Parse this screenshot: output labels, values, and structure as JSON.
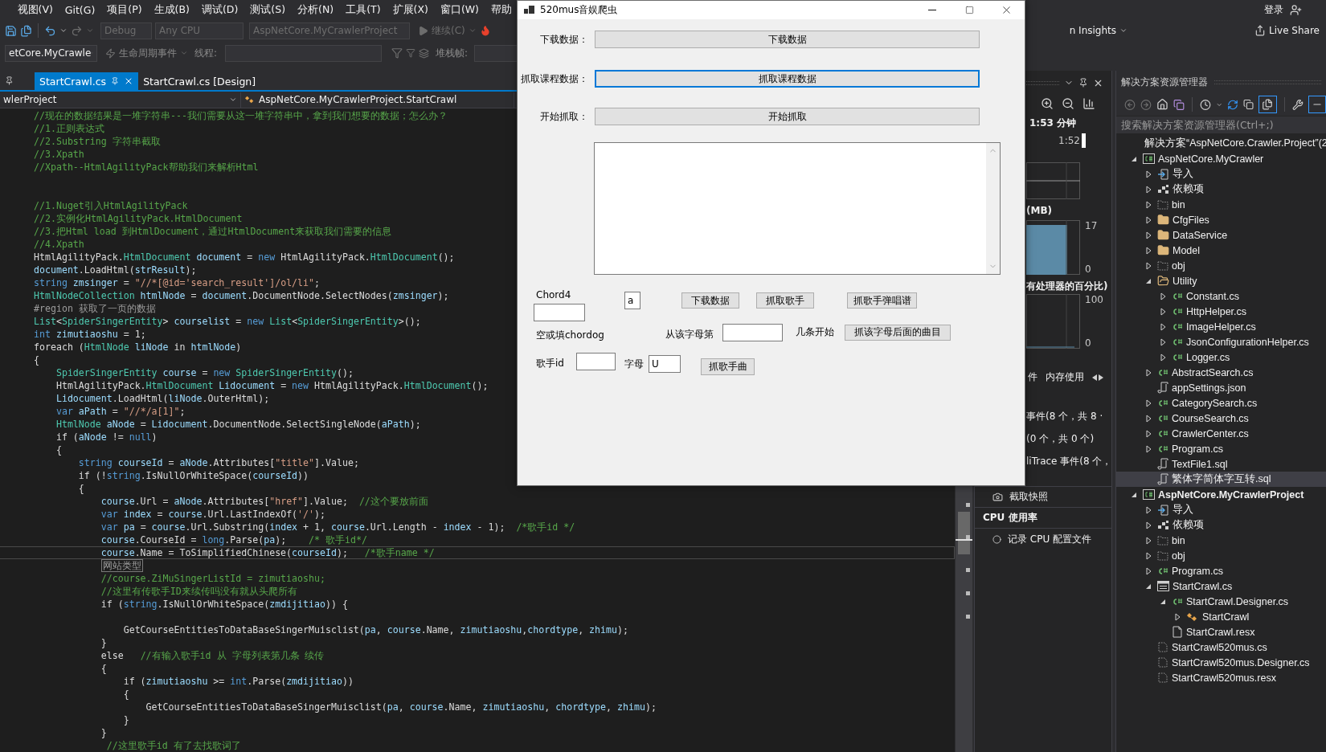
{
  "menu": {
    "items": [
      "视图(V)",
      "Git(G)",
      "项目(P)",
      "生成(B)",
      "调试(D)",
      "测试(S)",
      "分析(N)",
      "工具(T)",
      "扩展(X)",
      "窗口(W)",
      "帮助"
    ],
    "login": "登录"
  },
  "toolbar": {
    "config": {
      "text": "Debug",
      "disabled": true
    },
    "platform": {
      "text": "Any CPU",
      "disabled": true
    },
    "startup_project": {
      "text": "AspNetCore.MyCrawlerProject",
      "disabled": true
    },
    "continue": {
      "text": "继续(C)",
      "disabled": true
    },
    "insights": "n Insights",
    "live_share": "Live Share"
  },
  "debug_toolbar": {
    "process": "etCore.MyCrawle",
    "lifecycle": "生命周期事件",
    "thread_label": "线程:",
    "stack_label": "堆栈帧:"
  },
  "editor": {
    "tabs": [
      {
        "label": "StartCrawl.cs",
        "selected": true
      },
      {
        "label": "StartCrawl.cs [Design]",
        "selected": false
      }
    ],
    "nav_project": "wlerProject",
    "nav_class": "AspNetCore.MyCrawlerProject.StartCrawl",
    "lines": [
      {
        "kind": "code",
        "current": false,
        "tokens": [
          {
            "kind": "comment",
            "text": "//现在的数据结果是一堆字符串---我们需要从这一堆字符串中，拿到我们想要的数据；怎么办？"
          }
        ]
      },
      {
        "kind": "code",
        "current": false,
        "tokens": [
          {
            "kind": "comment",
            "text": "//1.正则表达式"
          }
        ]
      },
      {
        "kind": "code",
        "current": false,
        "tokens": [
          {
            "kind": "comment",
            "text": "//2.Substring 字符串截取"
          }
        ]
      },
      {
        "kind": "code",
        "current": false,
        "tokens": [
          {
            "kind": "comment",
            "text": "//3.Xpath"
          }
        ]
      },
      {
        "kind": "code",
        "current": false,
        "tokens": [
          {
            "kind": "comment",
            "text": "//Xpath--HtmlAgilityPack帮助我们来解析Html"
          }
        ]
      },
      {
        "kind": "blank",
        "current": false
      },
      {
        "kind": "blank",
        "current": false
      },
      {
        "kind": "code",
        "current": false,
        "tokens": [
          {
            "kind": "comment",
            "text": "//1.Nuget引入HtmlAgilityPack"
          }
        ]
      },
      {
        "kind": "code",
        "current": false,
        "tokens": [
          {
            "kind": "comment",
            "text": "//2.实例化HtmlAgilityPack.HtmlDocument"
          }
        ]
      },
      {
        "kind": "code",
        "current": false,
        "tokens": [
          {
            "kind": "comment",
            "text": "//3.把Html load 到HtmlDocument，通过HtmlDocument来获取我们需要的信息"
          }
        ]
      },
      {
        "kind": "code",
        "current": false,
        "tokens": [
          {
            "kind": "comment",
            "text": "//4.Xpath"
          }
        ]
      },
      {
        "kind": "code",
        "current": false,
        "tokens": [
          {
            "kind": "plain",
            "text": "HtmlAgilityPack."
          },
          {
            "kind": "type",
            "text": "HtmlDocument"
          },
          {
            "kind": "variable",
            "text": " document"
          },
          {
            "kind": "plain",
            "text": " = "
          },
          {
            "kind": "keyword",
            "text": "new"
          },
          {
            "kind": "plain",
            "text": " HtmlAgilityPack."
          },
          {
            "kind": "type",
            "text": "HtmlDocument"
          },
          {
            "kind": "plain",
            "text": "();"
          }
        ]
      },
      {
        "kind": "code",
        "current": false,
        "tokens": [
          {
            "kind": "variable",
            "text": "document"
          },
          {
            "kind": "plain",
            "text": ".LoadHtml("
          },
          {
            "kind": "variable",
            "text": "strResult"
          },
          {
            "kind": "plain",
            "text": ");"
          }
        ]
      },
      {
        "kind": "code",
        "current": false,
        "tokens": [
          {
            "kind": "keyword",
            "text": "string"
          },
          {
            "kind": "variable",
            "text": " zmsinger"
          },
          {
            "kind": "plain",
            "text": " = "
          },
          {
            "kind": "string",
            "text": "\"//*[@id='search_result']/ol/li\""
          },
          {
            "kind": "plain",
            "text": ";"
          }
        ]
      },
      {
        "kind": "code",
        "current": false,
        "tokens": [
          {
            "kind": "type",
            "text": "HtmlNodeCollection"
          },
          {
            "kind": "variable",
            "text": " htmlNode"
          },
          {
            "kind": "plain",
            "text": " = "
          },
          {
            "kind": "variable",
            "text": "document"
          },
          {
            "kind": "plain",
            "text": ".DocumentNode.SelectNodes("
          },
          {
            "kind": "variable",
            "text": "zmsinger"
          },
          {
            "kind": "plain",
            "text": ");"
          }
        ]
      },
      {
        "kind": "code",
        "current": false,
        "tokens": [
          {
            "kind": "directive",
            "text": "#region 获取了一页的数据"
          }
        ]
      },
      {
        "kind": "code",
        "current": false,
        "tokens": [
          {
            "kind": "type",
            "text": "List"
          },
          {
            "kind": "plain",
            "text": "<"
          },
          {
            "kind": "type",
            "text": "SpiderSingerEntity"
          },
          {
            "kind": "plain",
            "text": "> "
          },
          {
            "kind": "variable",
            "text": "courselist"
          },
          {
            "kind": "plain",
            "text": " = "
          },
          {
            "kind": "keyword",
            "text": "new"
          },
          {
            "kind": "type",
            "text": " List"
          },
          {
            "kind": "plain",
            "text": "<"
          },
          {
            "kind": "type",
            "text": "SpiderSingerEntity"
          },
          {
            "kind": "plain",
            "text": ">();"
          }
        ]
      },
      {
        "kind": "code",
        "current": false,
        "tokens": [
          {
            "kind": "keyword",
            "text": "int"
          },
          {
            "kind": "variable",
            "text": " zimutiaoshu"
          },
          {
            "kind": "plain",
            "text": " = 1;"
          }
        ]
      },
      {
        "kind": "code",
        "current": false,
        "tokens": [
          {
            "kind": "plain",
            "text": "foreach ("
          },
          {
            "kind": "type",
            "text": "HtmlNode"
          },
          {
            "kind": "variable",
            "text": " liNode"
          },
          {
            "kind": "plain",
            "text": " in "
          },
          {
            "kind": "variable",
            "text": "htmlNode"
          },
          {
            "kind": "plain",
            "text": ")"
          }
        ]
      },
      {
        "kind": "code",
        "current": false,
        "tokens": [
          {
            "kind": "plain",
            "text": "{"
          }
        ]
      },
      {
        "kind": "code",
        "current": false,
        "tokens": [
          {
            "kind": "type",
            "text": "    SpiderSingerEntity"
          },
          {
            "kind": "variable",
            "text": " course"
          },
          {
            "kind": "plain",
            "text": " = "
          },
          {
            "kind": "keyword",
            "text": "new"
          },
          {
            "kind": "type",
            "text": " SpiderSingerEntity"
          },
          {
            "kind": "plain",
            "text": "();"
          }
        ]
      },
      {
        "kind": "code",
        "current": false,
        "tokens": [
          {
            "kind": "plain",
            "text": "    HtmlAgilityPack."
          },
          {
            "kind": "type",
            "text": "HtmlDocument"
          },
          {
            "kind": "variable",
            "text": " Lidocument"
          },
          {
            "kind": "plain",
            "text": " = "
          },
          {
            "kind": "keyword",
            "text": "new"
          },
          {
            "kind": "plain",
            "text": " HtmlAgilityPack."
          },
          {
            "kind": "type",
            "text": "HtmlDocument"
          },
          {
            "kind": "plain",
            "text": "();"
          }
        ]
      },
      {
        "kind": "code",
        "current": false,
        "tokens": [
          {
            "kind": "variable",
            "text": "    Lidocument"
          },
          {
            "kind": "plain",
            "text": ".LoadHtml("
          },
          {
            "kind": "variable",
            "text": "liNode"
          },
          {
            "kind": "plain",
            "text": ".OuterHtml);"
          }
        ]
      },
      {
        "kind": "code",
        "current": false,
        "tokens": [
          {
            "kind": "keyword",
            "text": "    var"
          },
          {
            "kind": "variable",
            "text": " aPath"
          },
          {
            "kind": "plain",
            "text": " = "
          },
          {
            "kind": "string",
            "text": "\"//*/a[1]\""
          },
          {
            "kind": "plain",
            "text": ";"
          }
        ]
      },
      {
        "kind": "code",
        "current": false,
        "tokens": [
          {
            "kind": "type",
            "text": "    HtmlNode"
          },
          {
            "kind": "variable",
            "text": " aNode"
          },
          {
            "kind": "plain",
            "text": " = "
          },
          {
            "kind": "variable",
            "text": "Lidocument"
          },
          {
            "kind": "plain",
            "text": ".DocumentNode.SelectSingleNode("
          },
          {
            "kind": "variable",
            "text": "aPath"
          },
          {
            "kind": "plain",
            "text": ");"
          }
        ]
      },
      {
        "kind": "code",
        "current": false,
        "tokens": [
          {
            "kind": "plain",
            "text": "    if ("
          },
          {
            "kind": "variable",
            "text": "aNode"
          },
          {
            "kind": "plain",
            "text": " != "
          },
          {
            "kind": "keyword",
            "text": "null"
          },
          {
            "kind": "plain",
            "text": ")"
          }
        ]
      },
      {
        "kind": "code",
        "current": false,
        "tokens": [
          {
            "kind": "plain",
            "text": "    {"
          }
        ]
      },
      {
        "kind": "code",
        "current": false,
        "tokens": [
          {
            "kind": "keyword",
            "text": "        string"
          },
          {
            "kind": "variable",
            "text": " courseId"
          },
          {
            "kind": "plain",
            "text": " = "
          },
          {
            "kind": "variable",
            "text": "aNode"
          },
          {
            "kind": "plain",
            "text": ".Attributes["
          },
          {
            "kind": "string",
            "text": "\"title\""
          },
          {
            "kind": "plain",
            "text": "].Value;"
          }
        ]
      },
      {
        "kind": "code",
        "current": false,
        "tokens": [
          {
            "kind": "plain",
            "text": "        if (!"
          },
          {
            "kind": "keyword",
            "text": "string"
          },
          {
            "kind": "plain",
            "text": ".IsNullOrWhiteSpace("
          },
          {
            "kind": "variable",
            "text": "courseId"
          },
          {
            "kind": "plain",
            "text": "))"
          }
        ]
      },
      {
        "kind": "code",
        "current": false,
        "tokens": [
          {
            "kind": "plain",
            "text": "        {"
          }
        ]
      },
      {
        "kind": "code",
        "current": false,
        "tokens": [
          {
            "kind": "variable",
            "text": "            course"
          },
          {
            "kind": "plain",
            "text": ".Url = "
          },
          {
            "kind": "variable",
            "text": "aNode"
          },
          {
            "kind": "plain",
            "text": ".Attributes["
          },
          {
            "kind": "string",
            "text": "\"href\""
          },
          {
            "kind": "plain",
            "text": "].Value;  "
          },
          {
            "kind": "comment",
            "text": "//这个要放前面"
          }
        ]
      },
      {
        "kind": "code",
        "current": false,
        "tokens": [
          {
            "kind": "keyword",
            "text": "            var"
          },
          {
            "kind": "variable",
            "text": " index"
          },
          {
            "kind": "plain",
            "text": " = "
          },
          {
            "kind": "variable",
            "text": "course"
          },
          {
            "kind": "plain",
            "text": ".Url.LastIndexOf("
          },
          {
            "kind": "string",
            "text": "'/'"
          },
          {
            "kind": "plain",
            "text": ");"
          }
        ]
      },
      {
        "kind": "code",
        "current": false,
        "tokens": [
          {
            "kind": "keyword",
            "text": "            var"
          },
          {
            "kind": "variable",
            "text": " pa"
          },
          {
            "kind": "plain",
            "text": " = "
          },
          {
            "kind": "variable",
            "text": "course"
          },
          {
            "kind": "plain",
            "text": ".Url.Substring("
          },
          {
            "kind": "variable",
            "text": "index"
          },
          {
            "kind": "plain",
            "text": " + 1, "
          },
          {
            "kind": "variable",
            "text": "course"
          },
          {
            "kind": "plain",
            "text": ".Url.Length - "
          },
          {
            "kind": "variable",
            "text": "index"
          },
          {
            "kind": "plain",
            "text": " - 1);  "
          },
          {
            "kind": "comment",
            "text": "/*歌手id */"
          }
        ]
      },
      {
        "kind": "code",
        "current": false,
        "tokens": [
          {
            "kind": "variable",
            "text": "            course"
          },
          {
            "kind": "plain",
            "text": ".CourseId = "
          },
          {
            "kind": "keyword",
            "text": "long"
          },
          {
            "kind": "plain",
            "text": ".Parse("
          },
          {
            "kind": "variable",
            "text": "pa"
          },
          {
            "kind": "plain",
            "text": ");    "
          },
          {
            "kind": "comment",
            "text": "/* 歌手id*/"
          }
        ]
      },
      {
        "kind": "code",
        "current": true,
        "tokens": [
          {
            "kind": "variable",
            "text": "            course"
          },
          {
            "kind": "plain",
            "text": ".Name = ToSimplifiedChinese("
          },
          {
            "kind": "variable",
            "text": "courseId"
          },
          {
            "kind": "plain",
            "text": ");   "
          },
          {
            "kind": "comment",
            "text": "/*歌手name */"
          }
        ]
      },
      {
        "kind": "code",
        "current": false,
        "tokens": [
          {
            "kind": "boxed",
            "text": "            网站类型"
          }
        ]
      },
      {
        "kind": "code",
        "current": false,
        "tokens": [
          {
            "kind": "comment",
            "text": "            //course.ZiMuSingerListId = zimutiaoshu;"
          }
        ]
      },
      {
        "kind": "code",
        "current": false,
        "tokens": [
          {
            "kind": "comment",
            "text": "            //这里有传歌手ID来续传吗没有就从头爬所有"
          }
        ]
      },
      {
        "kind": "code",
        "current": false,
        "tokens": [
          {
            "kind": "plain",
            "text": "            if ("
          },
          {
            "kind": "keyword",
            "text": "string"
          },
          {
            "kind": "plain",
            "text": ".IsNullOrWhiteSpace("
          },
          {
            "kind": "variable",
            "text": "zmdijitiao"
          },
          {
            "kind": "plain",
            "text": ")) {"
          }
        ]
      },
      {
        "kind": "blank",
        "current": false
      },
      {
        "kind": "code",
        "current": false,
        "tokens": [
          {
            "kind": "plain",
            "text": "                GetCourseEntitiesToDataBaseSingerMuisclist("
          },
          {
            "kind": "variable",
            "text": "pa"
          },
          {
            "kind": "plain",
            "text": ", "
          },
          {
            "kind": "variable",
            "text": "course"
          },
          {
            "kind": "plain",
            "text": ".Name, "
          },
          {
            "kind": "variable",
            "text": "zimutiaoshu"
          },
          {
            "kind": "plain",
            "text": ","
          },
          {
            "kind": "variable",
            "text": "chordtype"
          },
          {
            "kind": "plain",
            "text": ", "
          },
          {
            "kind": "variable",
            "text": "zhimu"
          },
          {
            "kind": "plain",
            "text": ");"
          }
        ]
      },
      {
        "kind": "code",
        "current": false,
        "tokens": [
          {
            "kind": "plain",
            "text": "            }"
          }
        ]
      },
      {
        "kind": "code",
        "current": false,
        "tokens": [
          {
            "kind": "plain",
            "text": "            else   "
          },
          {
            "kind": "comment",
            "text": "//有输入歌手id 从 字母列表第几条 续传"
          }
        ]
      },
      {
        "kind": "code",
        "current": false,
        "tokens": [
          {
            "kind": "plain",
            "text": "            {"
          }
        ]
      },
      {
        "kind": "code",
        "current": false,
        "tokens": [
          {
            "kind": "plain",
            "text": "                if ("
          },
          {
            "kind": "variable",
            "text": "zimutiaoshu"
          },
          {
            "kind": "plain",
            "text": " >= "
          },
          {
            "kind": "keyword",
            "text": "int"
          },
          {
            "kind": "plain",
            "text": ".Parse("
          },
          {
            "kind": "variable",
            "text": "zmdijitiao"
          },
          {
            "kind": "plain",
            "text": "))"
          }
        ]
      },
      {
        "kind": "code",
        "current": false,
        "tokens": [
          {
            "kind": "plain",
            "text": "                {"
          }
        ]
      },
      {
        "kind": "code",
        "current": false,
        "tokens": [
          {
            "kind": "plain",
            "text": "                    GetCourseEntitiesToDataBaseSingerMuisclist("
          },
          {
            "kind": "variable",
            "text": "pa"
          },
          {
            "kind": "plain",
            "text": ", "
          },
          {
            "kind": "variable",
            "text": "course"
          },
          {
            "kind": "plain",
            "text": ".Name, "
          },
          {
            "kind": "variable",
            "text": "zimutiaoshu"
          },
          {
            "kind": "plain",
            "text": ", "
          },
          {
            "kind": "variable",
            "text": "chordtype"
          },
          {
            "kind": "plain",
            "text": ", "
          },
          {
            "kind": "variable",
            "text": "zhimu"
          },
          {
            "kind": "plain",
            "text": ");"
          }
        ]
      },
      {
        "kind": "code",
        "current": false,
        "tokens": [
          {
            "kind": "plain",
            "text": "                }"
          }
        ]
      },
      {
        "kind": "code",
        "current": false,
        "tokens": [
          {
            "kind": "plain",
            "text": "            }"
          }
        ]
      },
      {
        "kind": "code",
        "current": false,
        "tokens": [
          {
            "kind": "comment",
            "text": "             //这里歌手id 有了去找歌词了"
          }
        ]
      }
    ]
  },
  "diagnostics": {
    "session_time": "1:53 分钟",
    "timeline_tick": "1:52",
    "memory_label": "(MB)",
    "memory_ticks": [
      "17",
      "0"
    ],
    "cpu_label": "有处理器的百分比)",
    "cpu_ticks": [
      "100",
      "0"
    ],
    "tabs": [
      {
        "label": "件",
        "selected": false
      },
      {
        "label": "内存使用",
        "selected": false
      }
    ],
    "events": [
      "事件(8 个，共 8 ·",
      "(0 个，共 0 个)",
      "liTrace 事件(8 个，"
    ],
    "snapshot": "截取快照",
    "cpu_heading": "CPU 使用率",
    "record_cpu": "记录 CPU 配置文件"
  },
  "solution_explorer": {
    "title": "解决方案资源管理器",
    "search": {
      "placeholder": "搜索解决方案资源管理器(Ctrl+;)"
    },
    "solution": "解决方案“AspNetCore.Crawler.Project”(2",
    "projects": [
      {
        "label": "AspNetCore.MyCrawler",
        "kind": "project",
        "expanded": true,
        "selected": false,
        "startup": false,
        "children": [
          {
            "label": "导入",
            "kind": "import",
            "expanded": false,
            "selected": false
          },
          {
            "label": "依赖项",
            "kind": "dependencies",
            "expanded": false,
            "selected": false
          },
          {
            "label": "bin",
            "kind": "dotted-folder",
            "expanded": false,
            "selected": false
          },
          {
            "label": "CfgFiles",
            "kind": "folder",
            "expanded": false,
            "selected": false
          },
          {
            "label": "DataService",
            "kind": "folder",
            "expanded": false,
            "selected": false
          },
          {
            "label": "Model",
            "kind": "folder",
            "expanded": false,
            "selected": false
          },
          {
            "label": "obj",
            "kind": "dotted-folder",
            "expanded": false,
            "selected": false
          },
          {
            "label": "Utility",
            "kind": "folder",
            "expanded": true,
            "selected": false,
            "children": [
              {
                "label": "Constant.cs",
                "kind": "csharp",
                "expanded": false,
                "selected": false
              },
              {
                "label": "HttpHelper.cs",
                "kind": "csharp",
                "expanded": false,
                "selected": false
              },
              {
                "label": "ImageHelper.cs",
                "kind": "csharp",
                "expanded": false,
                "selected": false
              },
              {
                "label": "JsonConfigurationHelper.cs",
                "kind": "csharp",
                "expanded": false,
                "selected": false
              },
              {
                "label": "Logger.cs",
                "kind": "csharp",
                "expanded": false,
                "selected": false
              }
            ]
          },
          {
            "label": "AbstractSearch.cs",
            "kind": "csharp",
            "expanded": false,
            "selected": false
          },
          {
            "label": "appSettings.json",
            "kind": "script",
            "selected": false
          },
          {
            "label": "CategorySearch.cs",
            "kind": "csharp",
            "expanded": false,
            "selected": false
          },
          {
            "label": "CourseSearch.cs",
            "kind": "csharp",
            "expanded": false,
            "selected": false
          },
          {
            "label": "CrawlerCenter.cs",
            "kind": "csharp",
            "expanded": false,
            "selected": false
          },
          {
            "label": "Program.cs",
            "kind": "csharp",
            "expanded": false,
            "selected": false
          },
          {
            "label": "TextFile1.sql",
            "kind": "script",
            "selected": false
          },
          {
            "label": "繁体字简体字互转.sql",
            "kind": "script",
            "selected": true
          }
        ]
      },
      {
        "label": "AspNetCore.MyCrawlerProject",
        "kind": "project",
        "expanded": true,
        "selected": false,
        "startup": true,
        "children": [
          {
            "label": "导入",
            "kind": "import",
            "expanded": false,
            "selected": false
          },
          {
            "label": "依赖项",
            "kind": "dependencies",
            "expanded": false,
            "selected": false
          },
          {
            "label": "bin",
            "kind": "dotted-folder",
            "expanded": false,
            "selected": false
          },
          {
            "label": "obj",
            "kind": "dotted-folder",
            "expanded": false,
            "selected": false
          },
          {
            "label": "Program.cs",
            "kind": "csharp",
            "expanded": false,
            "selected": false
          },
          {
            "label": "StartCrawl.cs",
            "kind": "form",
            "expanded": true,
            "selected": false,
            "children": [
              {
                "label": "StartCrawl.Designer.cs",
                "kind": "csharp",
                "expanded": true,
                "selected": false,
                "children": [
                  {
                    "label": "StartCrawl",
                    "kind": "class",
                    "expanded": false,
                    "selected": false
                  }
                ]
              },
              {
                "label": "StartCrawl.resx",
                "kind": "file",
                "selected": false
              }
            ]
          },
          {
            "label": "StartCrawl520mus.cs",
            "kind": "dotted-file",
            "selected": false
          },
          {
            "label": "StartCrawl520mus.Designer.cs",
            "kind": "dotted-file",
            "selected": false
          },
          {
            "label": "StartCrawl520mus.resx",
            "kind": "dotted-file",
            "selected": false
          }
        ]
      }
    ]
  },
  "dialog": {
    "title": "520mus音娱爬虫",
    "rows": [
      {
        "label": "下载数据：",
        "button": "下载数据",
        "focused": false
      },
      {
        "label": "抓取课程数据：",
        "button": "抓取课程数据",
        "focused": true
      },
      {
        "label": "开始抓取：",
        "button": "开始抓取",
        "focused": false
      }
    ],
    "chord_label": "Chord4",
    "letter_field": {
      "value": "a"
    },
    "actions": [
      "下载数据",
      "抓取歌手",
      "抓歌手弹唱谱"
    ],
    "chord_hint": "空或填chordog",
    "from_label": "从该字母第",
    "start_label": "几条开始",
    "after_letter_button": "抓该字母后面的曲目",
    "singer_label": "歌手id",
    "letter_label": "字母",
    "letter_value_field": {
      "value": "U"
    },
    "singer_button": "抓歌手曲"
  }
}
